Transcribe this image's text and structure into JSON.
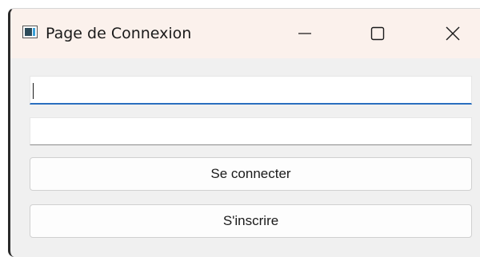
{
  "window": {
    "title": "Page de Connexion",
    "controls": {
      "minimize_icon": "minimize-icon",
      "maximize_icon": "maximize-icon",
      "close_icon": "close-icon"
    }
  },
  "form": {
    "username": {
      "value": "",
      "placeholder": ""
    },
    "password": {
      "value": "",
      "placeholder": ""
    },
    "login_button_label": "Se connecter",
    "signup_button_label": "S'inscrire"
  },
  "colors": {
    "titlebar_bg": "#fbf1ec",
    "window_bg": "#f0f0f0",
    "focus_accent": "#2a6fbf"
  }
}
